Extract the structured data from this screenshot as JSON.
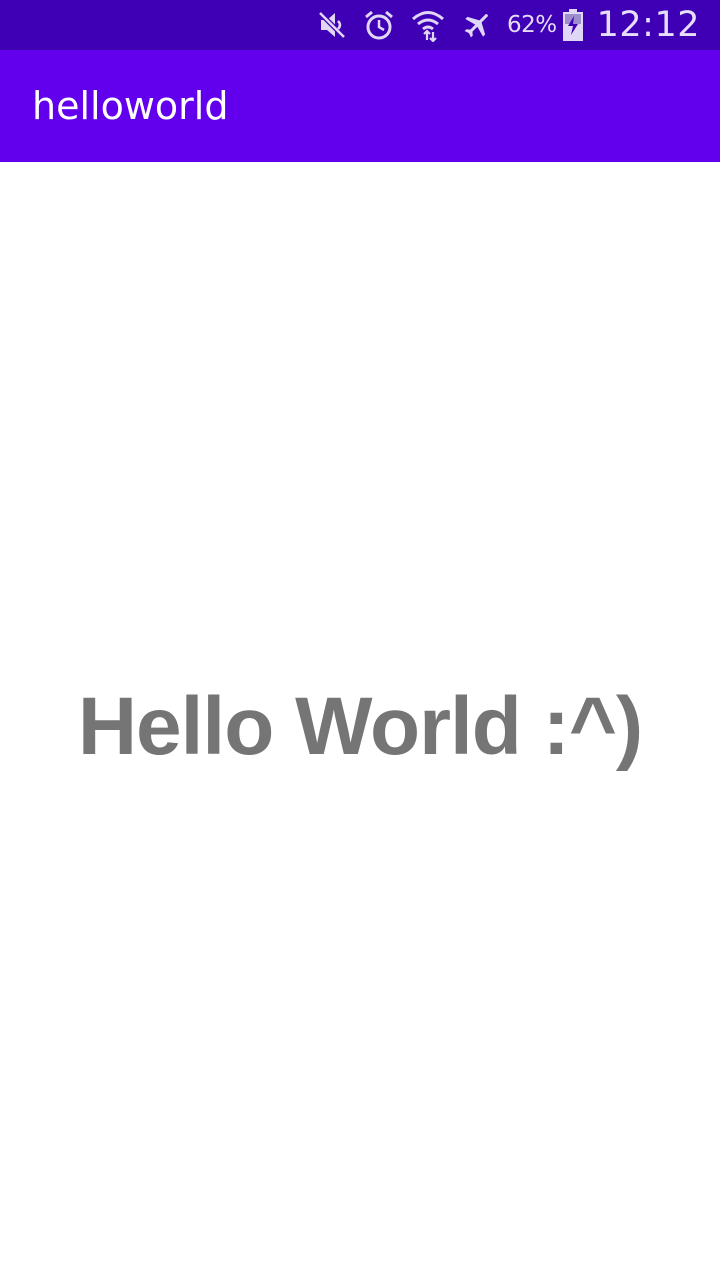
{
  "status_bar": {
    "icons": [
      "mute-icon",
      "alarm-icon",
      "wifi-icon",
      "airplane-mode-icon",
      "battery-charging-icon"
    ],
    "battery_percent": "62%",
    "time": "12:12",
    "background_color": "#3f00b5"
  },
  "app_bar": {
    "title": "helloworld",
    "background_color": "#6200ee"
  },
  "main": {
    "message": "Hello World :^)",
    "text_color": "#757575"
  }
}
